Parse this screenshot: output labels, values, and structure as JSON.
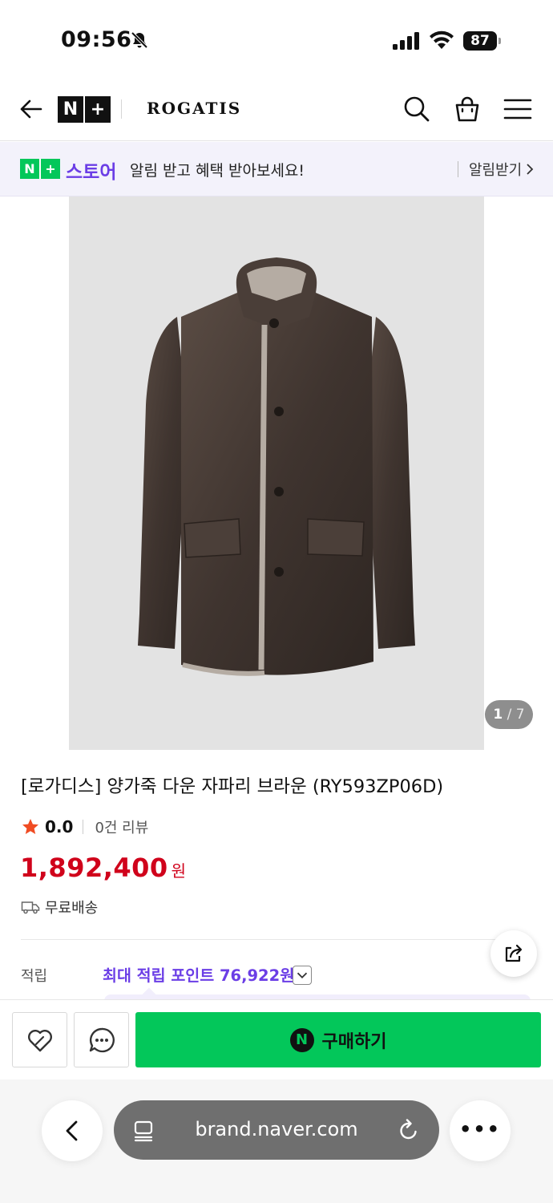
{
  "status_bar": {
    "time": "09:56",
    "battery": "87"
  },
  "header": {
    "logo_left": "N",
    "logo_right": "+",
    "brand": "ROGATIS"
  },
  "banner": {
    "logo_left": "N",
    "logo_right": "+",
    "store": "스토어",
    "message": "알림 받고 혜택 받아보세요!",
    "cta": "알림받기"
  },
  "gallery": {
    "current": "1",
    "separator": "/",
    "total": "7"
  },
  "product": {
    "title": "[로가디스] 양가죽 다운 자파리 브라운 (RY593ZP06D)",
    "rating": "0.0",
    "reviews": "0건 리뷰",
    "price": "1,892,400",
    "currency": "원",
    "shipping": "무료배송",
    "points_label": "적립",
    "points_value": "최대 적립 포인트 76,922원"
  },
  "buy_bar": {
    "npay_mark": "N",
    "buy_label": "구매하기"
  },
  "browser": {
    "url": "brand.naver.com",
    "more": "•••"
  },
  "colors": {
    "naver_green": "#03c75a",
    "store_purple": "#6b3ee6",
    "price_red": "#d0021b",
    "image_bg": "#e3e3e3"
  },
  "icons": [
    "bell-slash-icon",
    "signal-icon",
    "wifi-icon",
    "battery-icon",
    "back-arrow-icon",
    "search-icon",
    "cart-icon",
    "menu-icon",
    "chevron-right-icon",
    "star-icon",
    "truck-icon",
    "share-icon",
    "chevron-down-icon",
    "heart-icon",
    "chat-icon",
    "chevron-left-icon",
    "tabs-icon",
    "reload-icon"
  ]
}
